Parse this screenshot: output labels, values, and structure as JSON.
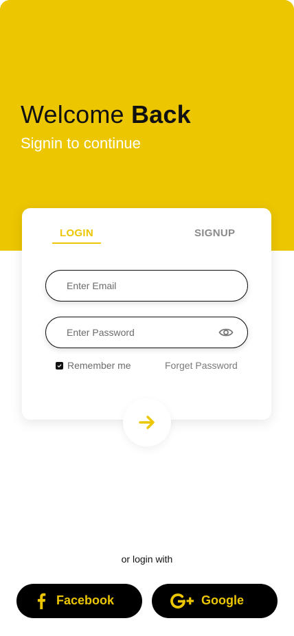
{
  "colors": {
    "accent": "#ecc600",
    "dark": "#000000",
    "muted": "#6b6b6b"
  },
  "header": {
    "welcome_plain": "Welcome ",
    "welcome_bold": "Back",
    "subtitle": "Signin to continue"
  },
  "tabs": {
    "login": "LOGIN",
    "signup": "SIGNUP",
    "active": "LOGIN"
  },
  "form": {
    "email_placeholder": "Enter Email",
    "password_placeholder": "Enter Password",
    "remember_label": "Remember me",
    "remember_checked": true,
    "forget_label": "Forget Password"
  },
  "icons": {
    "eye": "eye-icon",
    "arrow": "arrow-right-icon",
    "facebook": "facebook-icon",
    "google": "google-plus-icon"
  },
  "social": {
    "prompt": "or login with",
    "facebook_label": "Facebook",
    "google_label": "Google"
  }
}
